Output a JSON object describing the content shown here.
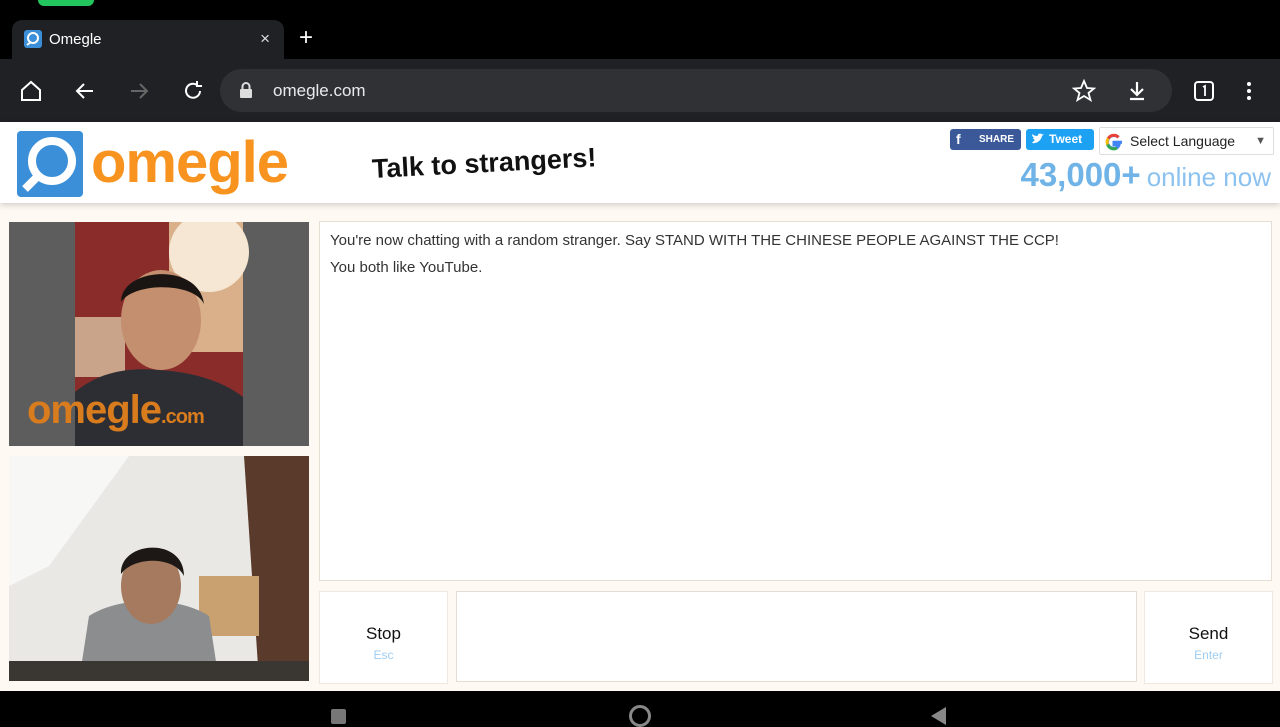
{
  "browser": {
    "tab_title": "Omegle",
    "tab_close": "×",
    "new_tab": "+",
    "url": "omegle.com"
  },
  "header": {
    "logo_text": "omegle",
    "tagline": "Talk to strangers!",
    "share_label": "SHARE",
    "tweet_label": "Tweet",
    "language_label": "Select Language",
    "online_count": "43,000+",
    "online_label": "online now"
  },
  "video": {
    "watermark_main": "omegle",
    "watermark_suffix": ".com"
  },
  "chat": {
    "messages": [
      "You're now chatting with a random stranger. Say STAND WITH THE CHINESE PEOPLE AGAINST THE CCP!",
      "You both like YouTube."
    ]
  },
  "controls": {
    "stop_label": "Stop",
    "stop_key": "Esc",
    "send_label": "Send",
    "send_key": "Enter"
  },
  "colors": {
    "brand_orange": "#f7931e",
    "brand_blue": "#3a8fd8",
    "online_blue": "#6fb3e7",
    "page_bg": "#fff9f4"
  },
  "icons": [
    "home-icon",
    "back-icon",
    "forward-icon",
    "reload-icon",
    "lock-icon",
    "star-icon",
    "download-icon",
    "tab-count-icon",
    "menu-icon",
    "facebook-icon",
    "twitter-icon",
    "google-icon"
  ]
}
